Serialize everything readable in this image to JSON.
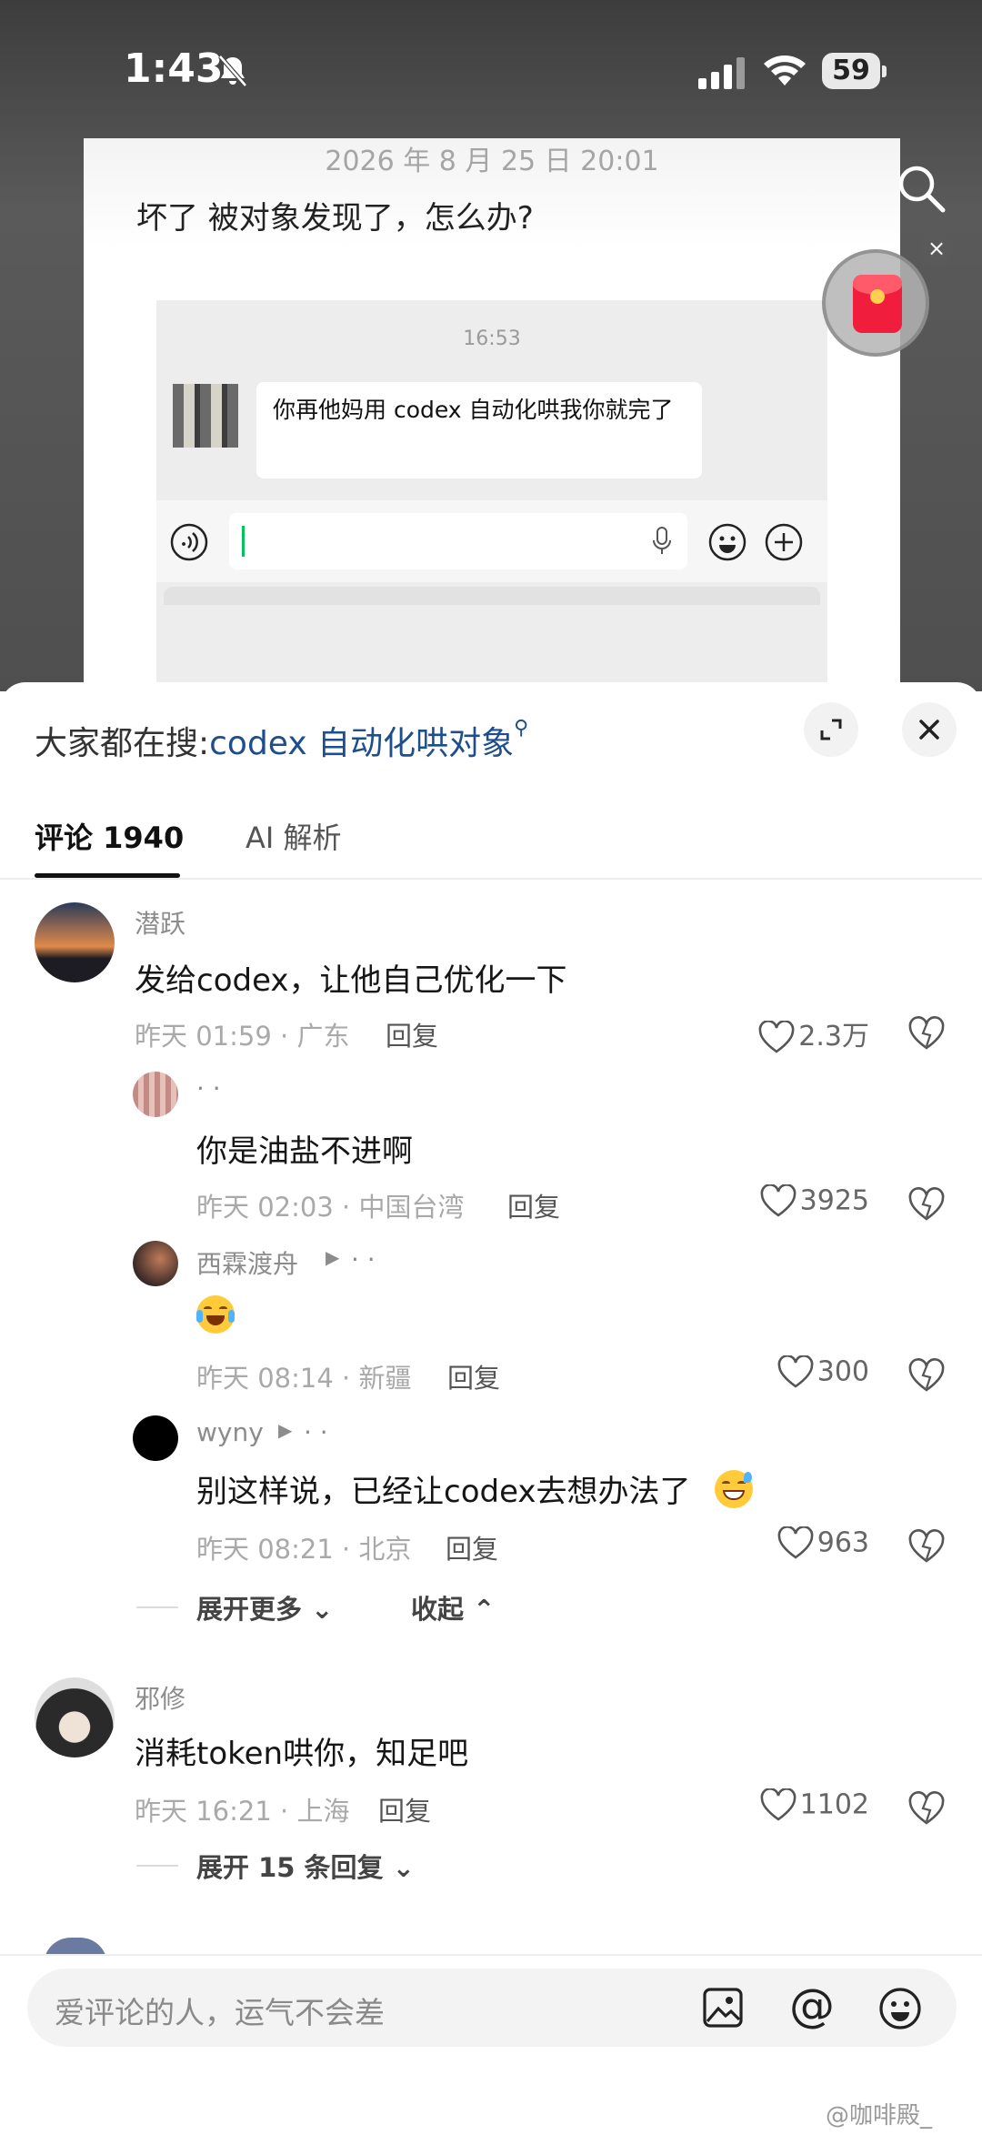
{
  "status_bar": {
    "time": "1:43",
    "battery": "59"
  },
  "post": {
    "date": "2026 年 8 月 25 日 20:01",
    "text": "坏了  被对象发现了，怎么办?",
    "chat": {
      "time": "16:53",
      "message": "你再他妈用 codex 自动化哄我你就完了"
    }
  },
  "sheet": {
    "hot_search_prefix": "大家都在搜:",
    "hot_search_keyword": "codex 自动化哄对象",
    "tabs": [
      {
        "label": "评论 1940"
      },
      {
        "label": "AI 解析"
      }
    ]
  },
  "comments": [
    {
      "user": "潜跃",
      "text": "发给codex，让他自己优化一下",
      "meta": "昨天 01:59 · 广东",
      "reply": "回复",
      "likes": "2.3万"
    },
    {
      "user": "·    ·",
      "text": "你是油盐不进啊",
      "meta": "昨天 02:03 · 中国台湾",
      "reply": "回复",
      "likes": "3925"
    },
    {
      "user": "西霖渡舟",
      "reply_to": "·      ·",
      "text": "",
      "meta": "昨天 08:14 · 新疆",
      "reply": "回复",
      "likes": "300"
    },
    {
      "user": "wyny",
      "reply_to": "·      ·",
      "text": "别这样说，已经让codex去想办法了",
      "meta": "昨天 08:21 · 北京",
      "reply": "回复",
      "likes": "963"
    },
    {
      "user": "邪修",
      "text": "消耗token哄你，知足吧",
      "meta": "昨天 16:21 · 上海",
      "reply": "回复",
      "likes": "1102"
    }
  ],
  "thread_links": {
    "expand_more": "展开更多",
    "collapse": "收起",
    "expand_replies": "展开 15 条回复"
  },
  "input": {
    "placeholder": "爱评论的人，运气不会差"
  },
  "watermark": "@咖啡殿_"
}
